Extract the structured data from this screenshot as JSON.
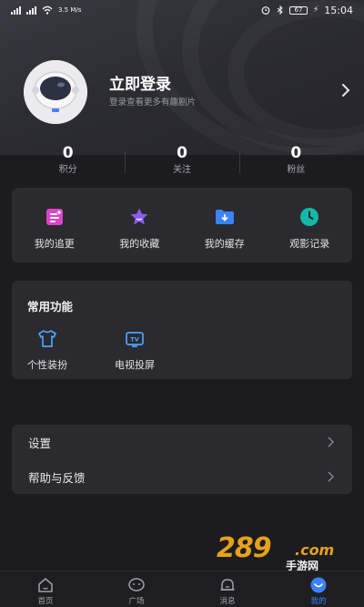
{
  "status_bar": {
    "left_text": "3.5 M/s",
    "time": "15:04",
    "battery": "67"
  },
  "profile": {
    "login_title": "立即登录",
    "login_subtitle": "登录查看更多有趣剧片"
  },
  "stats": [
    {
      "value": "0",
      "label": "积分"
    },
    {
      "value": "0",
      "label": "关注"
    },
    {
      "value": "0",
      "label": "粉丝"
    }
  ],
  "quick_actions": [
    {
      "label": "我的追更",
      "icon": "list-icon",
      "color": "#d946c8"
    },
    {
      "label": "我的收藏",
      "icon": "star-icon",
      "color": "#8b5cf6"
    },
    {
      "label": "我的缓存",
      "icon": "download-folder-icon",
      "color": "#3b82f6"
    },
    {
      "label": "观影记录",
      "icon": "clock-icon",
      "color": "#14b8a6"
    }
  ],
  "common_functions": {
    "title": "常用功能",
    "items": [
      {
        "label": "个性装扮",
        "icon": "shirt-icon"
      },
      {
        "label": "电视投屏",
        "icon": "tv-icon"
      }
    ]
  },
  "settings": [
    {
      "label": "设置"
    },
    {
      "label": "帮助与反馈"
    }
  ],
  "watermark": {
    "number": "289",
    "domain": ".com",
    "text": "手游网"
  },
  "tabs": [
    {
      "label": "首页",
      "icon": "home-icon"
    },
    {
      "label": "广场",
      "icon": "chat-bubble-icon"
    },
    {
      "label": "消息",
      "icon": "bell-icon"
    },
    {
      "label": "我的",
      "icon": "profile-icon",
      "active": true
    }
  ],
  "colors": {
    "background": "#1c1c20",
    "card": "#2a2a2f",
    "accent": "#3b82f6",
    "watermark": "#e6a21a"
  }
}
